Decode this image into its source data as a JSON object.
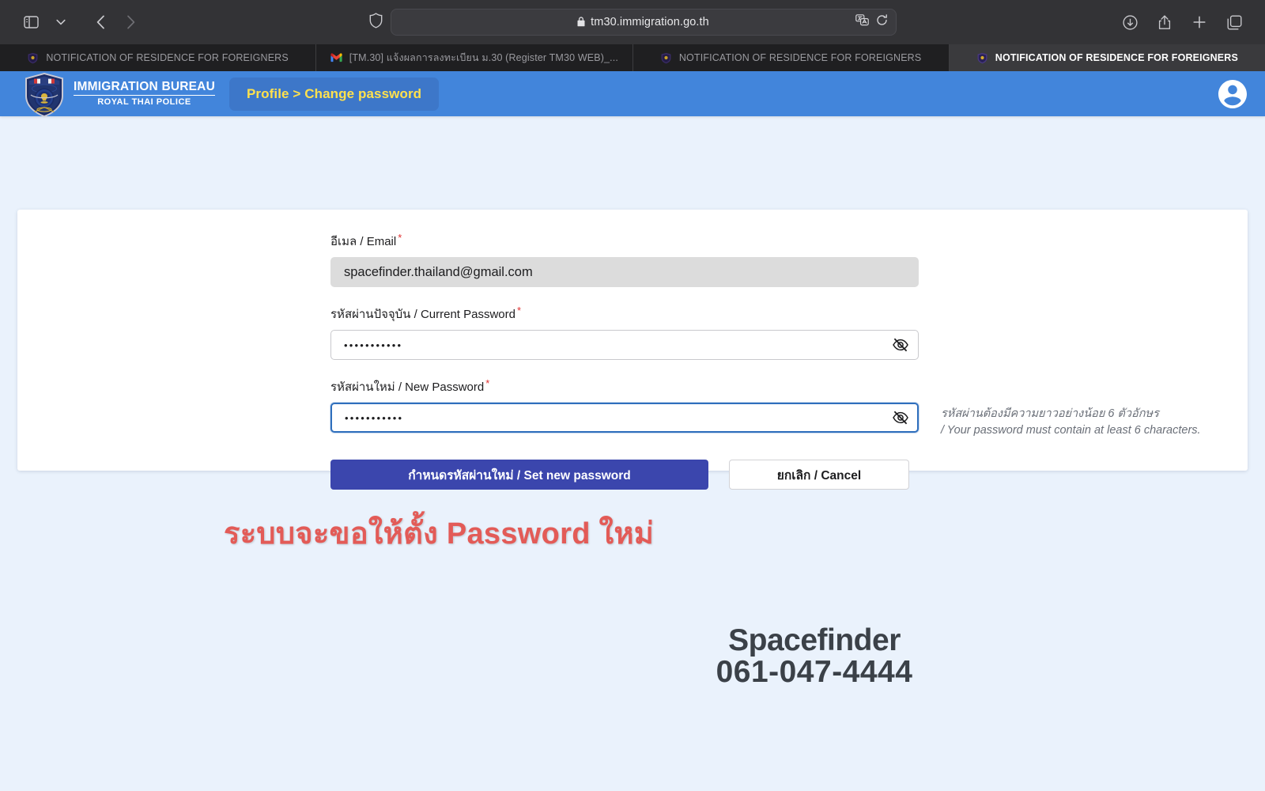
{
  "browser": {
    "url": "tm30.immigration.go.th",
    "url_lock_icon": "lock-icon",
    "toolbar_icons": {
      "sidebar": "sidebar-toggle-icon",
      "sidebar_menu": "chevron-down-icon",
      "back": "back-arrow-icon",
      "forward": "forward-arrow-icon",
      "shield": "privacy-shield-icon",
      "translate": "translate-icon",
      "reload": "reload-icon",
      "downloads": "download-icon",
      "share": "share-icon",
      "new_tab": "plus-icon",
      "tab_overview": "tab-overview-icon"
    },
    "tabs": [
      {
        "title": "NOTIFICATION OF RESIDENCE FOR FOREIGNERS",
        "favicon": "immigration-badge-icon",
        "active": false
      },
      {
        "title": "[TM.30] แจ้งผลการลงทะเบียน ม.30 (Register TM30 WEB)_...",
        "favicon": "gmail-icon",
        "active": false
      },
      {
        "title": "NOTIFICATION OF RESIDENCE FOR FOREIGNERS",
        "favicon": "immigration-badge-icon",
        "active": false
      },
      {
        "title": "NOTIFICATION OF RESIDENCE FOR FOREIGNERS",
        "favicon": "immigration-badge-icon",
        "active": true
      }
    ]
  },
  "site_header": {
    "brand_line1": "IMMIGRATION BUREAU",
    "brand_line2": "ROYAL THAI POLICE",
    "breadcrumb": "Profile > Change password",
    "avatar_icon": "account-circle-icon"
  },
  "form": {
    "email": {
      "label": "อีเมล / Email",
      "required_marker": "*",
      "value": "spacefinder.thailand@gmail.com",
      "disabled": true
    },
    "current_password": {
      "label": "รหัสผ่านปัจจุบัน / Current Password",
      "required_marker": "*",
      "value": "•••••••••••",
      "toggle_icon": "eye-off-icon"
    },
    "new_password": {
      "label": "รหัสผ่านใหม่ / New Password",
      "required_marker": "*",
      "value": "•••••••••••",
      "toggle_icon": "eye-off-icon",
      "focused": true
    },
    "hint_line1": "รหัสผ่านต้องมีความยาวอย่างน้อย 6 ตัวอักษร",
    "hint_line2": "/ Your password must contain at least 6 characters.",
    "submit_label": "กำหนดรหัสผ่านใหม่ / Set new password",
    "cancel_label": "ยกเลิก / Cancel"
  },
  "annotations": {
    "red_note": "ระบบจะขอให้ตั้ง Password ใหม่",
    "watermark_name": "Spacefinder",
    "watermark_phone": "061-047-4444"
  },
  "colors": {
    "header_blue": "#4285db",
    "breadcrumb_yellow": "#ffe14d",
    "primary_button": "#3b46ad",
    "page_background": "#eaf2fc",
    "annotation_red": "#e35b57",
    "required_red": "#e03131"
  }
}
